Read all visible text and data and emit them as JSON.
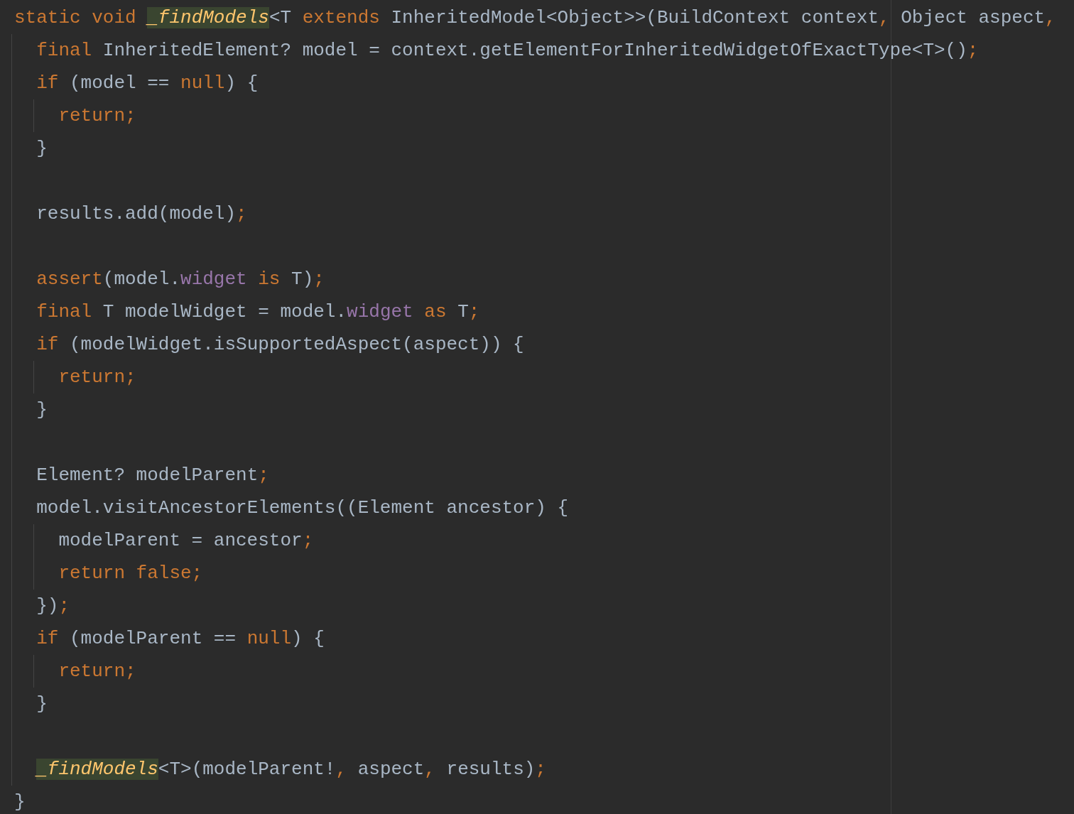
{
  "editor": {
    "lines": [
      {
        "kind": "code",
        "tokens": [
          {
            "text": "static void ",
            "kind": "keyword"
          },
          {
            "text": "_findModels",
            "kind": "usage"
          },
          {
            "text": "<T ",
            "kind": "plain"
          },
          {
            "text": "extends ",
            "kind": "keyword"
          },
          {
            "text": "InheritedModel<Object>>(BuildContext context",
            "kind": "plain"
          },
          {
            "text": ", ",
            "kind": "punct"
          },
          {
            "text": "Object aspect",
            "kind": "plain"
          },
          {
            "text": ",",
            "kind": "punct"
          }
        ],
        "children": [
          {
            "kind": "code",
            "tokens": [
              {
                "text": "final ",
                "kind": "keyword"
              },
              {
                "text": "InheritedElement? model = context.getElementForInheritedWidgetOfExactType<T>()",
                "kind": "plain"
              },
              {
                "text": ";",
                "kind": "punct"
              }
            ]
          },
          {
            "kind": "code",
            "tokens": [
              {
                "text": "if ",
                "kind": "keyword"
              },
              {
                "text": "(model == ",
                "kind": "plain"
              },
              {
                "text": "null",
                "kind": "keyword"
              },
              {
                "text": ") {",
                "kind": "plain"
              }
            ],
            "children": [
              {
                "kind": "code",
                "tokens": [
                  {
                    "text": "return;",
                    "kind": "keyword"
                  }
                ]
              }
            ]
          },
          {
            "kind": "code",
            "tokens": [
              {
                "text": "}",
                "kind": "plain"
              }
            ]
          },
          {
            "kind": "blank"
          },
          {
            "kind": "code",
            "tokens": [
              {
                "text": "results.add(model)",
                "kind": "plain"
              },
              {
                "text": ";",
                "kind": "punct"
              }
            ]
          },
          {
            "kind": "blank"
          },
          {
            "kind": "code",
            "tokens": [
              {
                "text": "assert",
                "kind": "keyword"
              },
              {
                "text": "(model.",
                "kind": "plain"
              },
              {
                "text": "widget",
                "kind": "field"
              },
              {
                "text": " is ",
                "kind": "keyword"
              },
              {
                "text": "T)",
                "kind": "plain"
              },
              {
                "text": ";",
                "kind": "punct"
              }
            ]
          },
          {
            "kind": "code",
            "tokens": [
              {
                "text": "final ",
                "kind": "keyword"
              },
              {
                "text": "T modelWidget = model.",
                "kind": "plain"
              },
              {
                "text": "widget",
                "kind": "field"
              },
              {
                "text": " as ",
                "kind": "keyword"
              },
              {
                "text": "T",
                "kind": "plain"
              },
              {
                "text": ";",
                "kind": "punct"
              }
            ]
          },
          {
            "kind": "code",
            "tokens": [
              {
                "text": "if ",
                "kind": "keyword"
              },
              {
                "text": "(modelWidget.isSupportedAspect(aspect)) {",
                "kind": "plain"
              }
            ],
            "children": [
              {
                "kind": "code",
                "tokens": [
                  {
                    "text": "return;",
                    "kind": "keyword"
                  }
                ]
              }
            ]
          },
          {
            "kind": "code",
            "tokens": [
              {
                "text": "}",
                "kind": "plain"
              }
            ]
          },
          {
            "kind": "blank"
          },
          {
            "kind": "code",
            "tokens": [
              {
                "text": "Element? modelParent",
                "kind": "plain"
              },
              {
                "text": ";",
                "kind": "punct"
              }
            ]
          },
          {
            "kind": "code",
            "tokens": [
              {
                "text": "model.visitAncestorElements((Element ancestor) {",
                "kind": "plain"
              }
            ],
            "children": [
              {
                "kind": "code",
                "tokens": [
                  {
                    "text": "modelParent = ancestor",
                    "kind": "plain"
                  },
                  {
                    "text": ";",
                    "kind": "punct"
                  }
                ]
              },
              {
                "kind": "code",
                "tokens": [
                  {
                    "text": "return false;",
                    "kind": "keyword"
                  }
                ]
              }
            ]
          },
          {
            "kind": "code",
            "tokens": [
              {
                "text": "})",
                "kind": "plain"
              },
              {
                "text": ";",
                "kind": "punct"
              }
            ]
          },
          {
            "kind": "code",
            "tokens": [
              {
                "text": "if ",
                "kind": "keyword"
              },
              {
                "text": "(modelParent == ",
                "kind": "plain"
              },
              {
                "text": "null",
                "kind": "keyword"
              },
              {
                "text": ") {",
                "kind": "plain"
              }
            ],
            "children": [
              {
                "kind": "code",
                "tokens": [
                  {
                    "text": "return;",
                    "kind": "keyword"
                  }
                ]
              }
            ]
          },
          {
            "kind": "code",
            "tokens": [
              {
                "text": "}",
                "kind": "plain"
              }
            ]
          },
          {
            "kind": "blank"
          },
          {
            "kind": "code",
            "tokens": [
              {
                "text": "_findModels",
                "kind": "usage"
              },
              {
                "text": "<T>(modelParent!",
                "kind": "plain"
              },
              {
                "text": ", ",
                "kind": "punct"
              },
              {
                "text": "aspect",
                "kind": "plain"
              },
              {
                "text": ", ",
                "kind": "punct"
              },
              {
                "text": "results)",
                "kind": "plain"
              },
              {
                "text": ";",
                "kind": "punct"
              }
            ]
          }
        ]
      },
      {
        "kind": "code",
        "tokens": [
          {
            "text": "}",
            "kind": "plain"
          }
        ]
      }
    ]
  }
}
